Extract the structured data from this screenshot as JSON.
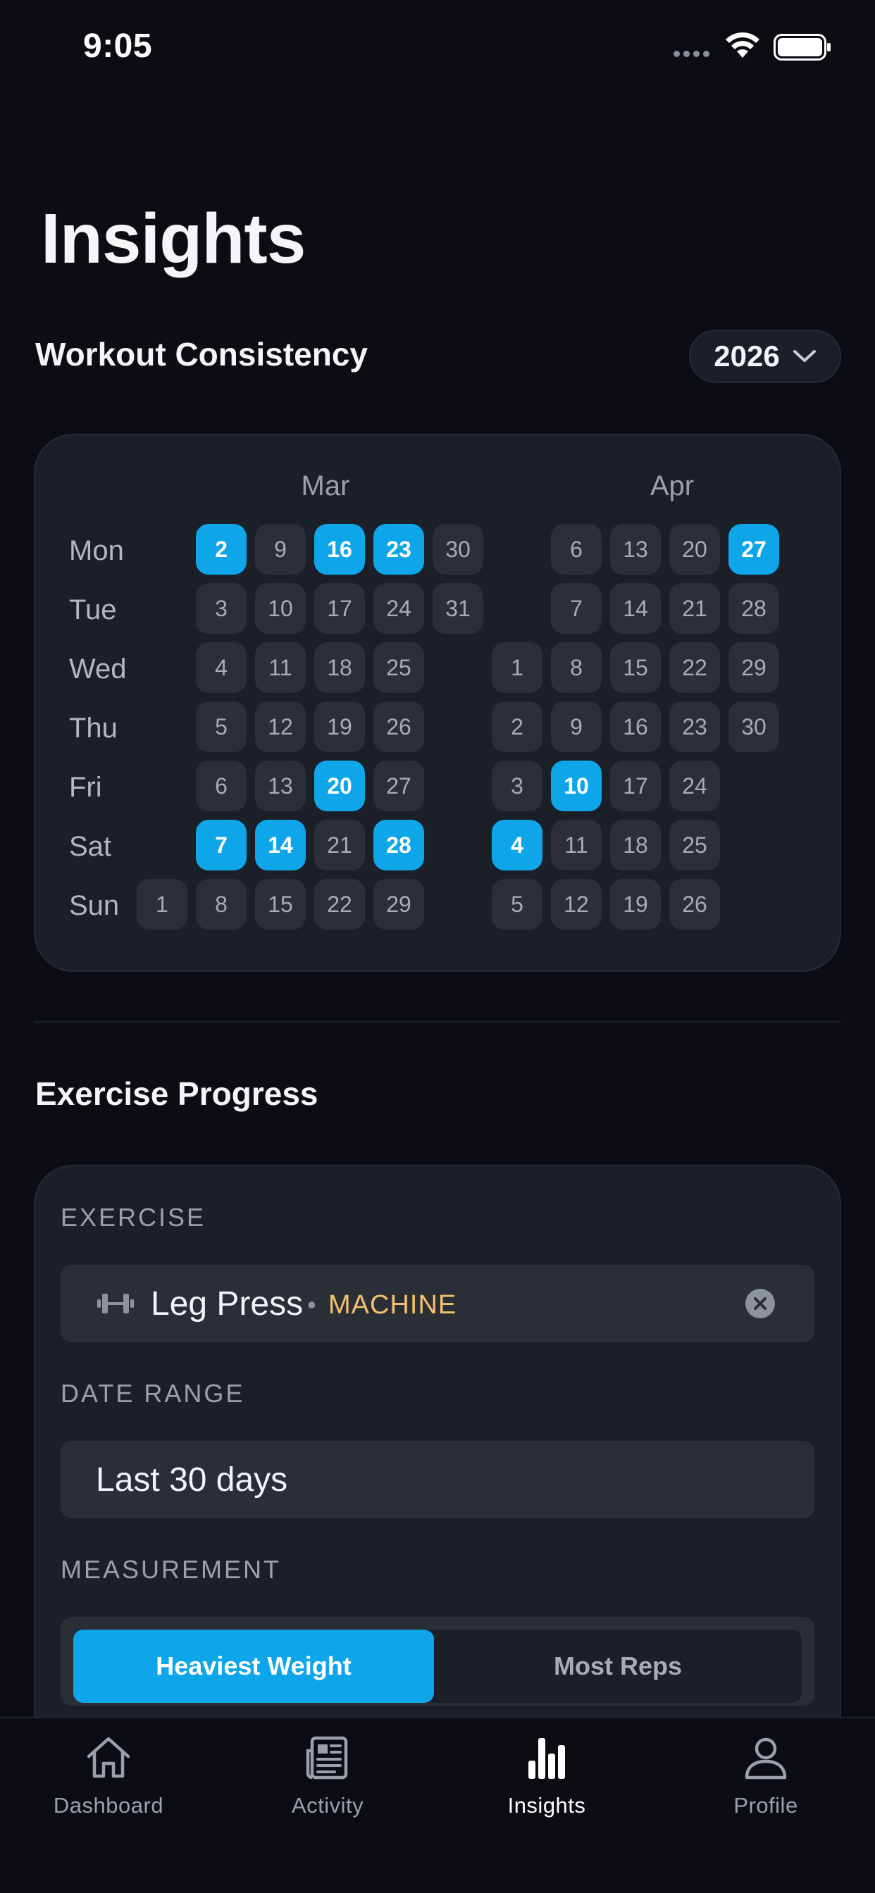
{
  "status_bar": {
    "time": "9:05"
  },
  "page": {
    "title": "Insights"
  },
  "consistency": {
    "title": "Workout Consistency",
    "year": "2026",
    "months": [
      "Mar",
      "Apr"
    ],
    "days": [
      "Mon",
      "Tue",
      "Wed",
      "Thu",
      "Fri",
      "Sat",
      "Sun"
    ],
    "weeks": [
      [
        "",
        "",
        "",
        "",
        "",
        "",
        "1"
      ],
      [
        "2",
        "3",
        "4",
        "5",
        "6",
        "7",
        "8"
      ],
      [
        "9",
        "10",
        "11",
        "12",
        "13",
        "14",
        "15"
      ],
      [
        "16",
        "17",
        "18",
        "19",
        "20",
        "21",
        "22"
      ],
      [
        "23",
        "24",
        "25",
        "26",
        "27",
        "28",
        "29"
      ],
      [
        "30",
        "31",
        "",
        "",
        "",
        "",
        ""
      ],
      [
        "",
        "",
        "1",
        "2",
        "3",
        "4",
        "5"
      ],
      [
        "6",
        "7",
        "8",
        "9",
        "10",
        "11",
        "12"
      ],
      [
        "13",
        "14",
        "15",
        "16",
        "17",
        "18",
        "19"
      ],
      [
        "20",
        "21",
        "22",
        "23",
        "24",
        "25",
        "26"
      ],
      [
        "27",
        "28",
        "29",
        "30",
        "",
        "",
        ""
      ]
    ],
    "active": [
      [
        1,
        0
      ],
      [
        1,
        5
      ],
      [
        2,
        5
      ],
      [
        3,
        0
      ],
      [
        3,
        4
      ],
      [
        4,
        0
      ],
      [
        4,
        5
      ],
      [
        6,
        5
      ],
      [
        7,
        4
      ],
      [
        10,
        0
      ]
    ],
    "colors": {
      "active": "#0ea5e9",
      "inactive": "#2a2f38"
    }
  },
  "progress": {
    "title": "Exercise Progress",
    "exercise_label": "EXERCISE",
    "exercise_name": "Leg Press",
    "exercise_separator": "•",
    "exercise_type": "MACHINE",
    "date_range_label": "DATE RANGE",
    "date_range_value": "Last 30 days",
    "measurement_label": "MEASUREMENT",
    "measurement_options": [
      "Heaviest Weight",
      "Most Reps"
    ],
    "measurement_selected": "Heaviest Weight"
  },
  "tabs": [
    {
      "label": "Dashboard",
      "icon": "house-icon",
      "active": false
    },
    {
      "label": "Activity",
      "icon": "newspaper-icon",
      "active": false
    },
    {
      "label": "Insights",
      "icon": "bar-chart-icon",
      "active": true
    },
    {
      "label": "Profile",
      "icon": "person-icon",
      "active": false
    }
  ]
}
